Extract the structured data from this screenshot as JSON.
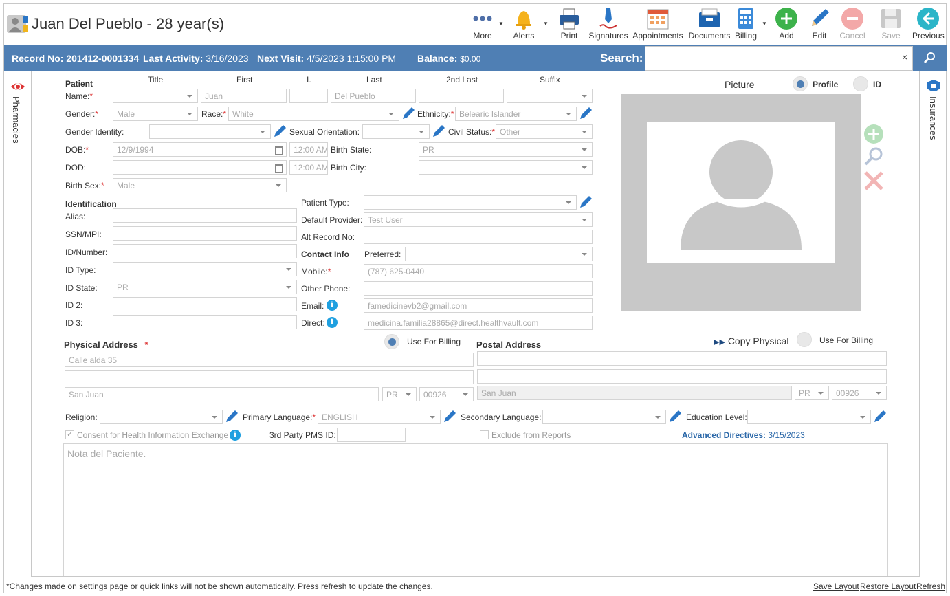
{
  "header": {
    "title": "Juan Del Pueblo - 28 year(s)"
  },
  "toolbar": {
    "more": "More",
    "alerts": "Alerts",
    "print": "Print",
    "signatures": "Signatures",
    "appointments": "Appointments",
    "documents": "Documents",
    "billing": "Billing",
    "add": "Add",
    "edit": "Edit",
    "cancel": "Cancel",
    "save": "Save",
    "previous": "Previous"
  },
  "infobar": {
    "record_label": "Record No:",
    "record_value": "201412-0001334",
    "activity_label": "Last Activity:",
    "activity_value": "3/16/2023",
    "visit_label": "Next Visit:",
    "visit_value": "4/5/2023 1:15:00 PM",
    "balance_label": "Balance:",
    "balance_value": "$0.00",
    "search_label": "Search:",
    "search_value": "",
    "clear": "×"
  },
  "side": {
    "left": "Pharmacies",
    "right": "Insurances"
  },
  "patient": {
    "section": "Patient",
    "col_title": "Title",
    "col_first": "First",
    "col_initial": "I.",
    "col_last": "Last",
    "col_last2": "2nd Last",
    "col_suffix": "Suffix",
    "name_label": "Name:",
    "title": "",
    "first": "Juan",
    "initial": "",
    "last": "Del Pueblo",
    "last2": "",
    "suffix": "",
    "gender_label": "Gender:",
    "gender": "Male",
    "race_label": "Race:",
    "race": "White",
    "ethnicity_label": "Ethnicity:",
    "ethnicity": "Belearic Islander",
    "gender_identity_label": "Gender Identity:",
    "gender_identity": "",
    "orientation_label": "Sexual Orientation:",
    "orientation": "",
    "civil_label": "Civil Status:",
    "civil": "Other",
    "dob_label": "DOB:",
    "dob": "12/9/1994",
    "dob_time": "12:00 AM",
    "birth_state_label": "Birth State:",
    "birth_state": "PR",
    "dod_label": "DOD:",
    "dod": "",
    "dod_time": "12:00 AM",
    "birth_city_label": "Birth City:",
    "birth_city": "",
    "birth_sex_label": "Birth Sex:",
    "birth_sex": "Male"
  },
  "identification": {
    "section": "Identification",
    "alias_label": "Alias:",
    "ssn_label": "SSN/MPI:",
    "idnum_label": "ID/Number:",
    "idtype_label": "ID Type:",
    "idstate_label": "ID State:",
    "idstate": "PR",
    "id2_label": "ID 2:",
    "id3_label": "ID 3:"
  },
  "right_fields": {
    "patient_type_label": "Patient Type:",
    "patient_type": "",
    "provider_label": "Default Provider:",
    "provider": "Test User",
    "alt_label": "Alt Record No:",
    "alt": "",
    "contact_section": "Contact Info",
    "preferred_label": "Preferred:",
    "preferred": "",
    "mobile_label": "Mobile:",
    "mobile": "(787) 625-0440",
    "other_phone_label": "Other Phone:",
    "other_phone": "",
    "email_label": "Email:",
    "email": "famedicinevb2@gmail.com",
    "direct_label": "Direct:",
    "direct": "medicina.familia28865@direct.healthvault.com"
  },
  "picture": {
    "label": "Picture",
    "profile": "Profile",
    "id": "ID"
  },
  "physical": {
    "title": "Physical Address",
    "billing_label": "Use For Billing",
    "line1": "Calle alda 35",
    "line2": "",
    "city": "San Juan",
    "state": "PR",
    "zip": "00926"
  },
  "postal": {
    "title": "Postal Address",
    "copy": "Copy Physical",
    "billing_label": "Use For Billing",
    "line1": "",
    "line2": "",
    "city": "San Juan",
    "state": "PR",
    "zip": "00926"
  },
  "misc": {
    "religion_label": "Religion:",
    "religion": "",
    "primary_label": "Primary Language:",
    "primary": "ENGLISH",
    "secondary_label": "Secondary Language:",
    "secondary": "",
    "education_label": "Education Level:",
    "education": "",
    "consent": "Consent for Health Information Exchange",
    "pms_label": "3rd Party PMS ID:",
    "pms": "",
    "exclude": "Exclude from Reports",
    "directives_label": "Advanced Directives:",
    "directives_value": "3/15/2023",
    "note_placeholder": "Nota del Paciente."
  },
  "footer": {
    "notice": "*Changes made on settings page or quick links will not be shown automatically. Press refresh to update the changes.",
    "save_layout": "Save Layout",
    "restore_layout": "Restore Layout",
    "refresh": "Refresh"
  },
  "colors": {
    "bar": "#4f7fb4",
    "required": "#d33",
    "info": "#1fa0e0",
    "add_green": "#3db24b",
    "cancel_red": "#e66"
  }
}
